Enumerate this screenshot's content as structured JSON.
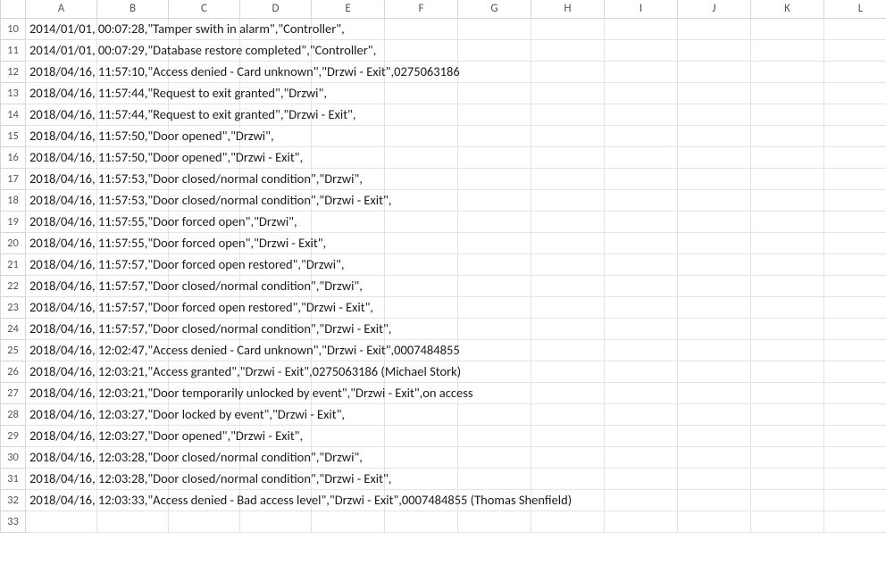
{
  "columns": [
    "A",
    "B",
    "C",
    "D",
    "E",
    "F",
    "G",
    "H",
    "I",
    "J",
    "K",
    "L"
  ],
  "row_start": 10,
  "row_end": 33,
  "rows": [
    {
      "n": 10,
      "text": "2014/01/01, 00:07:28,\"Tamper swith in alarm\",\"Controller\","
    },
    {
      "n": 11,
      "text": "2014/01/01, 00:07:29,\"Database restore completed\",\"Controller\","
    },
    {
      "n": 12,
      "text": "2018/04/16, 11:57:10,\"Access denied - Card unknown\",\"Drzwi - Exit\",0275063186"
    },
    {
      "n": 13,
      "text": "2018/04/16, 11:57:44,\"Request to exit granted\",\"Drzwi\","
    },
    {
      "n": 14,
      "text": "2018/04/16, 11:57:44,\"Request to exit granted\",\"Drzwi - Exit\","
    },
    {
      "n": 15,
      "text": "2018/04/16, 11:57:50,\"Door opened\",\"Drzwi\","
    },
    {
      "n": 16,
      "text": "2018/04/16, 11:57:50,\"Door opened\",\"Drzwi - Exit\","
    },
    {
      "n": 17,
      "text": "2018/04/16, 11:57:53,\"Door closed/normal condition\",\"Drzwi\","
    },
    {
      "n": 18,
      "text": "2018/04/16, 11:57:53,\"Door closed/normal condition\",\"Drzwi - Exit\","
    },
    {
      "n": 19,
      "text": "2018/04/16, 11:57:55,\"Door forced open\",\"Drzwi\","
    },
    {
      "n": 20,
      "text": "2018/04/16, 11:57:55,\"Door forced open\",\"Drzwi - Exit\","
    },
    {
      "n": 21,
      "text": "2018/04/16, 11:57:57,\"Door forced open restored\",\"Drzwi\","
    },
    {
      "n": 22,
      "text": "2018/04/16, 11:57:57,\"Door closed/normal condition\",\"Drzwi\","
    },
    {
      "n": 23,
      "text": "2018/04/16, 11:57:57,\"Door forced open restored\",\"Drzwi - Exit\","
    },
    {
      "n": 24,
      "text": "2018/04/16, 11:57:57,\"Door closed/normal condition\",\"Drzwi - Exit\","
    },
    {
      "n": 25,
      "text": "2018/04/16, 12:02:47,\"Access denied - Card unknown\",\"Drzwi - Exit\",0007484855"
    },
    {
      "n": 26,
      "text": "2018/04/16, 12:03:21,\"Access granted\",\"Drzwi - Exit\",0275063186 (Michael Stork)"
    },
    {
      "n": 27,
      "text": "2018/04/16, 12:03:21,\"Door temporarily unlocked by event\",\"Drzwi - Exit\",on access"
    },
    {
      "n": 28,
      "text": "2018/04/16, 12:03:27,\"Door locked by event\",\"Drzwi - Exit\","
    },
    {
      "n": 29,
      "text": "2018/04/16, 12:03:27,\"Door opened\",\"Drzwi - Exit\","
    },
    {
      "n": 30,
      "text": "2018/04/16, 12:03:28,\"Door closed/normal condition\",\"Drzwi\","
    },
    {
      "n": 31,
      "text": "2018/04/16, 12:03:28,\"Door closed/normal condition\",\"Drzwi - Exit\","
    },
    {
      "n": 32,
      "text": "2018/04/16, 12:03:33,\"Access denied - Bad access level\",\"Drzwi - Exit\",0007484855 (Thomas Shenfield)"
    },
    {
      "n": 33,
      "text": ""
    }
  ]
}
